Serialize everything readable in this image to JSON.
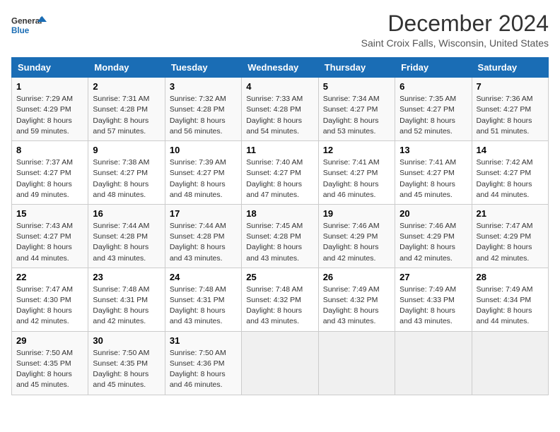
{
  "logo": {
    "text_general": "General",
    "text_blue": "Blue"
  },
  "title": "December 2024",
  "subtitle": "Saint Croix Falls, Wisconsin, United States",
  "days_of_week": [
    "Sunday",
    "Monday",
    "Tuesday",
    "Wednesday",
    "Thursday",
    "Friday",
    "Saturday"
  ],
  "weeks": [
    [
      {
        "day": "1",
        "sunrise": "7:29 AM",
        "sunset": "4:29 PM",
        "daylight": "8 hours and 59 minutes."
      },
      {
        "day": "2",
        "sunrise": "7:31 AM",
        "sunset": "4:28 PM",
        "daylight": "8 hours and 57 minutes."
      },
      {
        "day": "3",
        "sunrise": "7:32 AM",
        "sunset": "4:28 PM",
        "daylight": "8 hours and 56 minutes."
      },
      {
        "day": "4",
        "sunrise": "7:33 AM",
        "sunset": "4:28 PM",
        "daylight": "8 hours and 54 minutes."
      },
      {
        "day": "5",
        "sunrise": "7:34 AM",
        "sunset": "4:27 PM",
        "daylight": "8 hours and 53 minutes."
      },
      {
        "day": "6",
        "sunrise": "7:35 AM",
        "sunset": "4:27 PM",
        "daylight": "8 hours and 52 minutes."
      },
      {
        "day": "7",
        "sunrise": "7:36 AM",
        "sunset": "4:27 PM",
        "daylight": "8 hours and 51 minutes."
      }
    ],
    [
      {
        "day": "8",
        "sunrise": "7:37 AM",
        "sunset": "4:27 PM",
        "daylight": "8 hours and 49 minutes."
      },
      {
        "day": "9",
        "sunrise": "7:38 AM",
        "sunset": "4:27 PM",
        "daylight": "8 hours and 48 minutes."
      },
      {
        "day": "10",
        "sunrise": "7:39 AM",
        "sunset": "4:27 PM",
        "daylight": "8 hours and 48 minutes."
      },
      {
        "day": "11",
        "sunrise": "7:40 AM",
        "sunset": "4:27 PM",
        "daylight": "8 hours and 47 minutes."
      },
      {
        "day": "12",
        "sunrise": "7:41 AM",
        "sunset": "4:27 PM",
        "daylight": "8 hours and 46 minutes."
      },
      {
        "day": "13",
        "sunrise": "7:41 AM",
        "sunset": "4:27 PM",
        "daylight": "8 hours and 45 minutes."
      },
      {
        "day": "14",
        "sunrise": "7:42 AM",
        "sunset": "4:27 PM",
        "daylight": "8 hours and 44 minutes."
      }
    ],
    [
      {
        "day": "15",
        "sunrise": "7:43 AM",
        "sunset": "4:27 PM",
        "daylight": "8 hours and 44 minutes."
      },
      {
        "day": "16",
        "sunrise": "7:44 AM",
        "sunset": "4:28 PM",
        "daylight": "8 hours and 43 minutes."
      },
      {
        "day": "17",
        "sunrise": "7:44 AM",
        "sunset": "4:28 PM",
        "daylight": "8 hours and 43 minutes."
      },
      {
        "day": "18",
        "sunrise": "7:45 AM",
        "sunset": "4:28 PM",
        "daylight": "8 hours and 43 minutes."
      },
      {
        "day": "19",
        "sunrise": "7:46 AM",
        "sunset": "4:29 PM",
        "daylight": "8 hours and 42 minutes."
      },
      {
        "day": "20",
        "sunrise": "7:46 AM",
        "sunset": "4:29 PM",
        "daylight": "8 hours and 42 minutes."
      },
      {
        "day": "21",
        "sunrise": "7:47 AM",
        "sunset": "4:29 PM",
        "daylight": "8 hours and 42 minutes."
      }
    ],
    [
      {
        "day": "22",
        "sunrise": "7:47 AM",
        "sunset": "4:30 PM",
        "daylight": "8 hours and 42 minutes."
      },
      {
        "day": "23",
        "sunrise": "7:48 AM",
        "sunset": "4:31 PM",
        "daylight": "8 hours and 42 minutes."
      },
      {
        "day": "24",
        "sunrise": "7:48 AM",
        "sunset": "4:31 PM",
        "daylight": "8 hours and 43 minutes."
      },
      {
        "day": "25",
        "sunrise": "7:48 AM",
        "sunset": "4:32 PM",
        "daylight": "8 hours and 43 minutes."
      },
      {
        "day": "26",
        "sunrise": "7:49 AM",
        "sunset": "4:32 PM",
        "daylight": "8 hours and 43 minutes."
      },
      {
        "day": "27",
        "sunrise": "7:49 AM",
        "sunset": "4:33 PM",
        "daylight": "8 hours and 43 minutes."
      },
      {
        "day": "28",
        "sunrise": "7:49 AM",
        "sunset": "4:34 PM",
        "daylight": "8 hours and 44 minutes."
      }
    ],
    [
      {
        "day": "29",
        "sunrise": "7:50 AM",
        "sunset": "4:35 PM",
        "daylight": "8 hours and 45 minutes."
      },
      {
        "day": "30",
        "sunrise": "7:50 AM",
        "sunset": "4:35 PM",
        "daylight": "8 hours and 45 minutes."
      },
      {
        "day": "31",
        "sunrise": "7:50 AM",
        "sunset": "4:36 PM",
        "daylight": "8 hours and 46 minutes."
      },
      null,
      null,
      null,
      null
    ]
  ],
  "labels": {
    "sunrise": "Sunrise:",
    "sunset": "Sunset:",
    "daylight": "Daylight:"
  }
}
